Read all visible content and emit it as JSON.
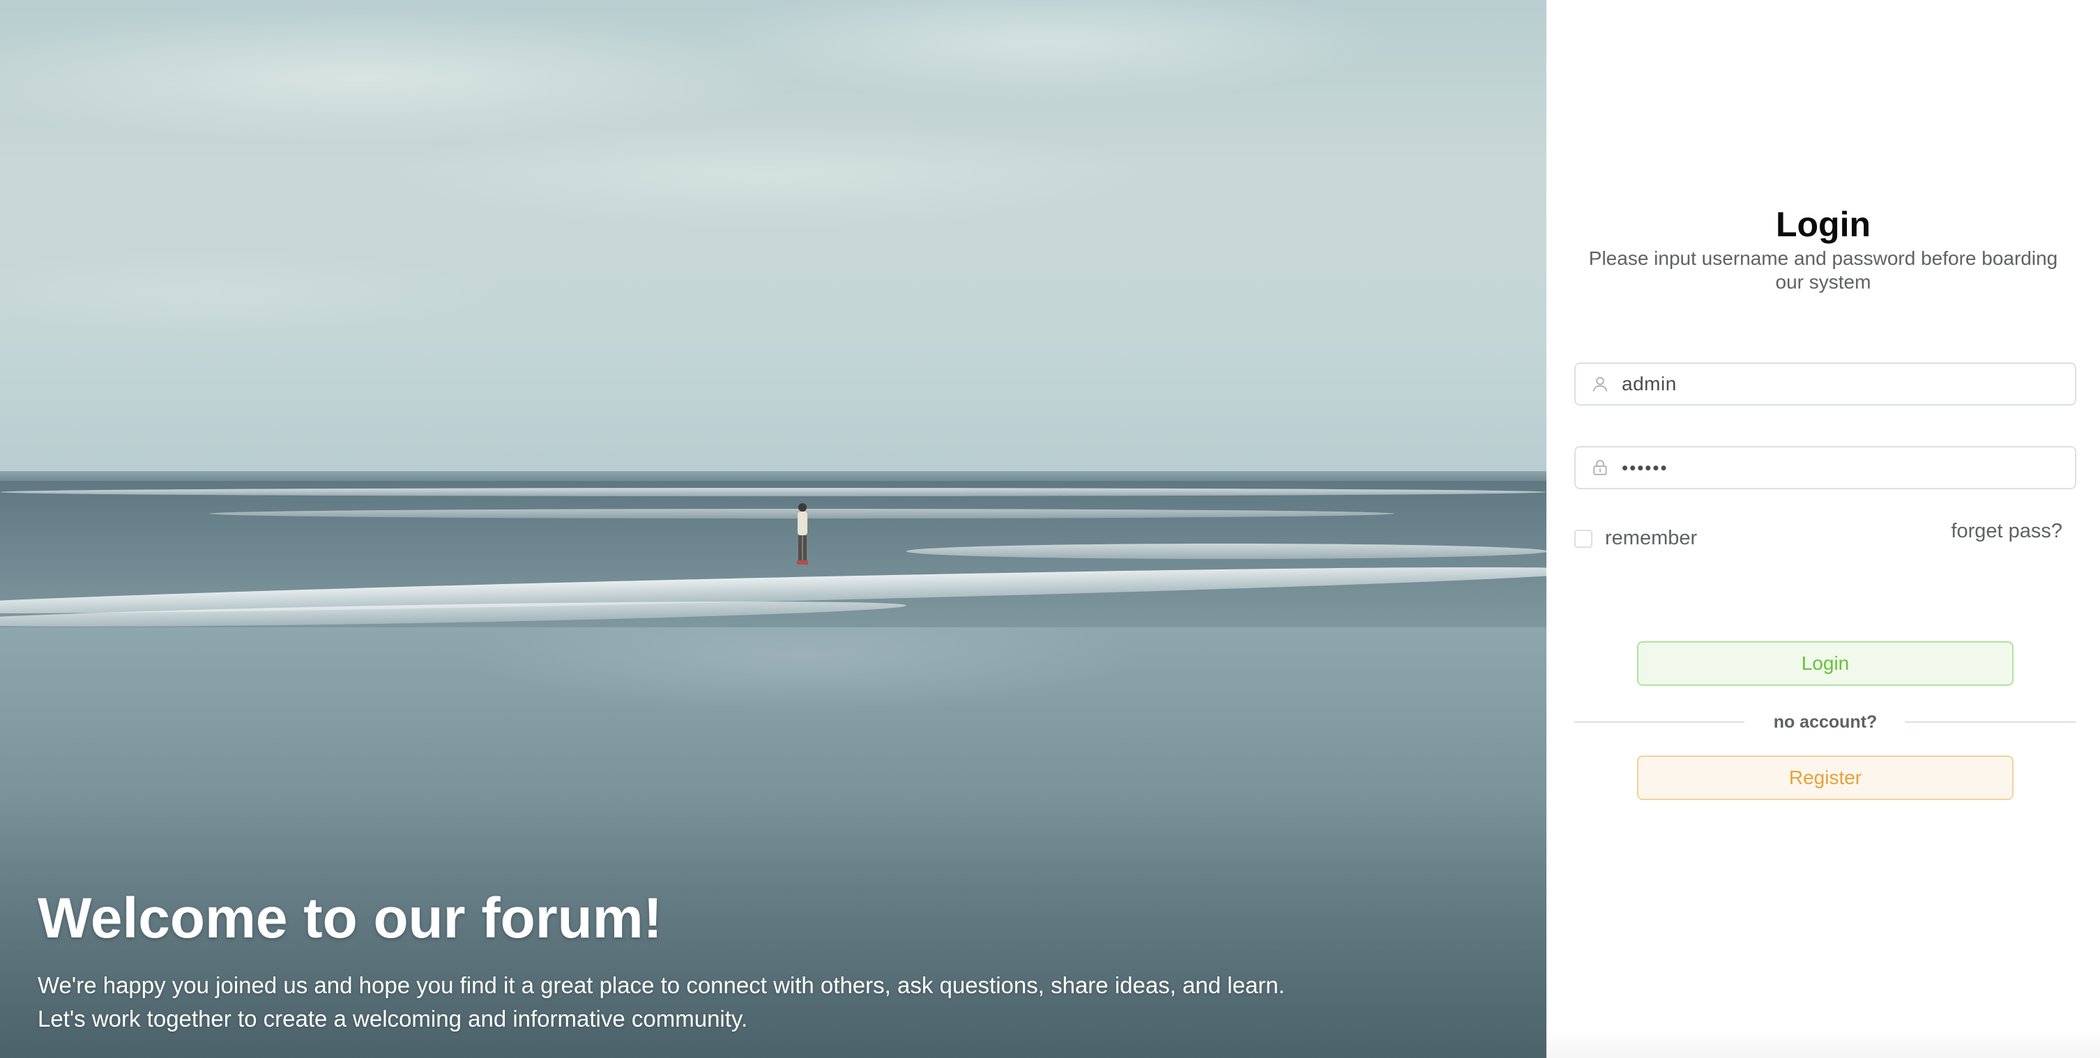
{
  "hero": {
    "title": "Welcome to our forum!",
    "subtitle_line1": "We're happy you joined us and hope you find it a great place to connect with others, ask questions, share ideas, and learn.",
    "subtitle_line2": "Let's work together to create a welcoming and informative community."
  },
  "login": {
    "title": "Login",
    "description": "Please input username and password before boarding our system",
    "username": {
      "value": "admin",
      "icon": "user-icon"
    },
    "password": {
      "value": "••••••",
      "icon": "lock-icon"
    },
    "remember_label": "remember",
    "remember_checked": false,
    "forget_label": "forget pass?",
    "login_button": "Login",
    "divider_text": "no account?",
    "register_button": "Register"
  },
  "colors": {
    "login_button_text": "#67c23a",
    "login_button_bg": "#f0f9eb",
    "login_button_border": "#b3e19d",
    "register_button_text": "#e6a23c",
    "register_button_bg": "#fdf6ec",
    "register_button_border": "#f3d19e"
  }
}
